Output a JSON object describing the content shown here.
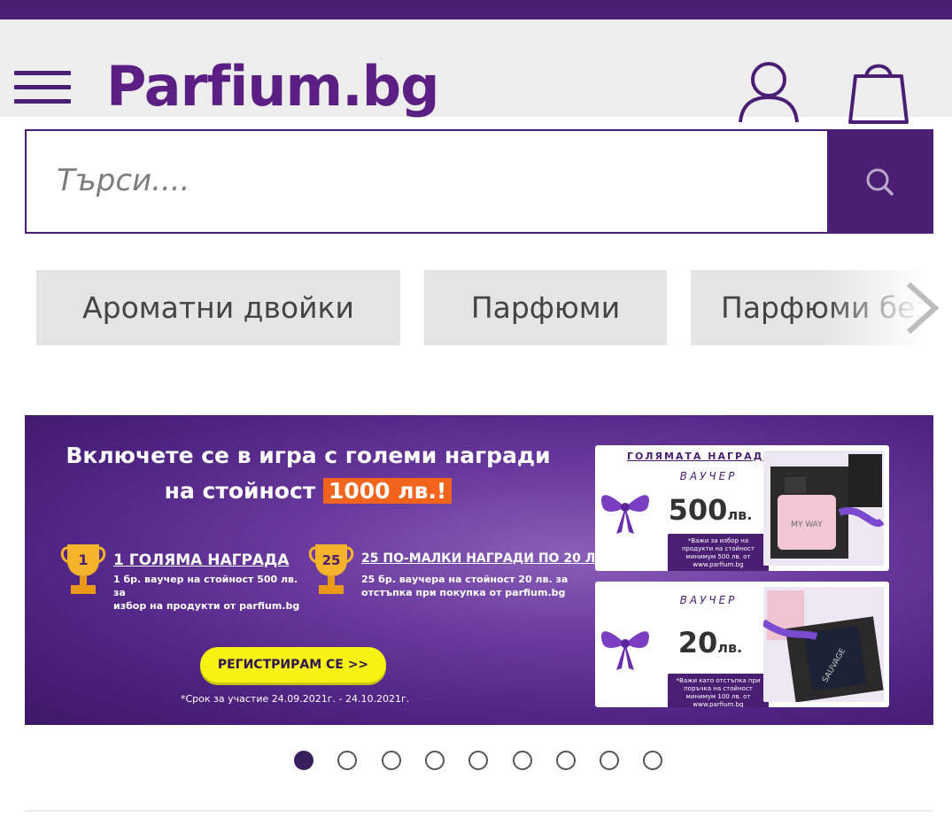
{
  "brand": {
    "logo_text": "Parfium.bg",
    "color": "#4a1f73"
  },
  "header": {
    "menu_icon": "hamburger-icon",
    "account_icon": "user-icon",
    "cart_icon": "shopping-bag-icon"
  },
  "search": {
    "placeholder": "Търси....",
    "button_icon": "search-icon"
  },
  "categories": {
    "items": [
      "Ароматни двойки",
      "Парфюми",
      "Парфюми без"
    ],
    "next_icon": "chevron-right-icon"
  },
  "banner": {
    "title_line1": "Включете се в игра с големи награди",
    "title_line2_prefix": "на стойност ",
    "title_amount": "1000 лв.!",
    "prize_main_number": "1",
    "prize_main_head": "1 ГОЛЯМА НАГРАДА",
    "prize_main_desc_1": "1 бр. ваучер на стойност 500 лв. за",
    "prize_main_desc_2": "избор на продукти от parfium.bg",
    "prize_small_number": "25",
    "prize_small_head": "25 ПО-МАЛКИ НАГРАДИ ПО 20 ЛВ.",
    "prize_small_desc_1": "25 бр. ваучера на стойност 20 лв. за",
    "prize_small_desc_2": "отстъпка при покупка от parfium.bg",
    "register_button": "РЕГИСТРИРАМ СЕ >>",
    "term_note": "*Срок за участие 24.09.2021г. - 24.10.2021г.",
    "voucher_main_heading": "ГОЛЯМАТА НАГРАДА",
    "voucher_word": "ВАУЧЕР",
    "voucher_main_amount": "500",
    "voucher_small_amount": "20",
    "voucher_currency": "лв.",
    "voucher_main_note": "*Важи за избор на продукти на стойност минимум 500 лв. от www.parfium.bg",
    "voucher_small_note": "*Важи като отстъпка при поръчка на стойност минимум 100 лв. от www.parfium.bg",
    "product_main_label": "MY WAY",
    "product_small_label": "SAUVAGE"
  },
  "carousel": {
    "total": 9,
    "active": 1
  },
  "colors": {
    "accent": "#4a1f73",
    "amount_bg": "#f2631b",
    "cta": "#f7f214"
  }
}
